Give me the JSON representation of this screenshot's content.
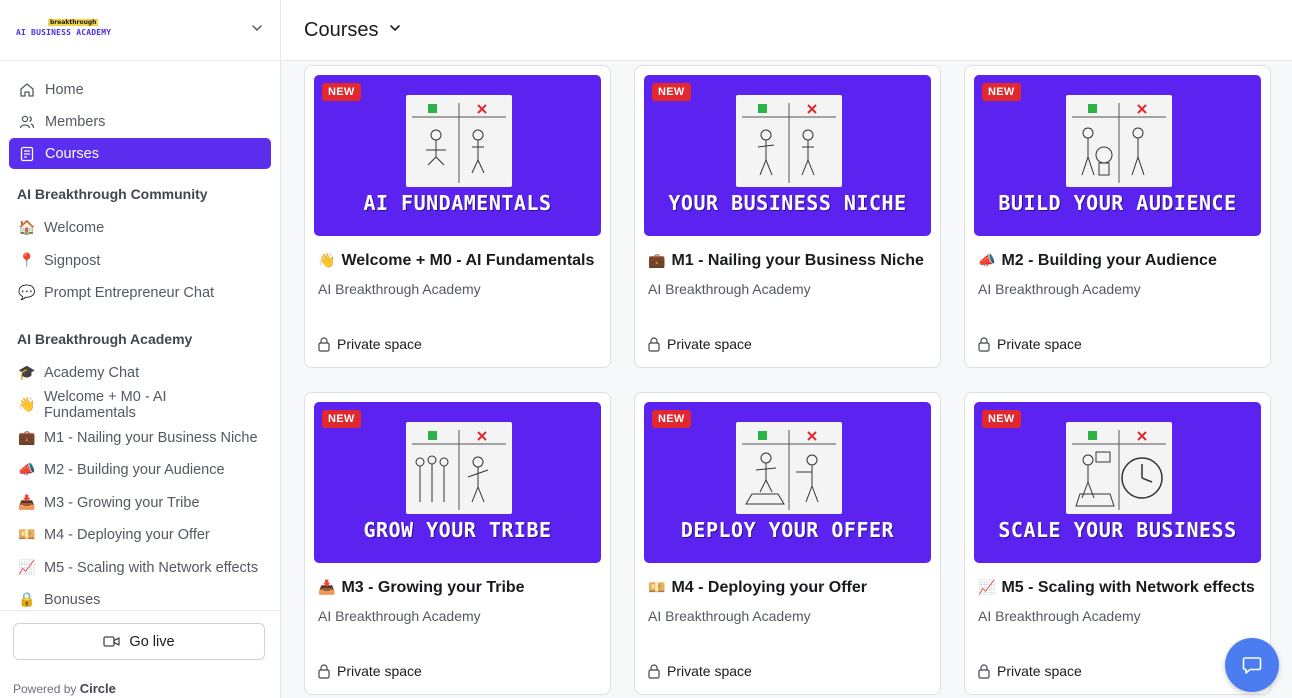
{
  "brand": {
    "logo_top": "breakthrough",
    "logo_bottom": "AI BUSINESS ACADEMY"
  },
  "nav": {
    "home": "Home",
    "members": "Members",
    "courses": "Courses"
  },
  "community": {
    "title": "AI Breakthrough Community",
    "items": [
      {
        "emoji": "🏠",
        "label": "Welcome"
      },
      {
        "emoji": "📍",
        "label": "Signpost"
      },
      {
        "emoji": "💬",
        "label": "Prompt Entrepreneur Chat"
      }
    ]
  },
  "academy": {
    "title": "AI Breakthrough Academy",
    "items": [
      {
        "emoji": "🎓",
        "label": "Academy Chat"
      },
      {
        "emoji": "👋",
        "label": "Welcome + M0 - AI Fundamentals"
      },
      {
        "emoji": "💼",
        "label": "M1 - Nailing your Business Niche"
      },
      {
        "emoji": "📣",
        "label": "M2 - Building your Audience"
      },
      {
        "emoji": "📥",
        "label": "M3 - Growing your Tribe"
      },
      {
        "emoji": "💴",
        "label": "M4 - Deploying your Offer"
      },
      {
        "emoji": "📈",
        "label": "M5 - Scaling with Network effects"
      },
      {
        "emoji": "🔒",
        "label": "Bonuses"
      }
    ]
  },
  "footer": {
    "go_live": "Go live",
    "powered_by": "Powered by",
    "powered_brand": "Circle"
  },
  "header": {
    "title": "Courses"
  },
  "cards": [
    {
      "badge": "NEW",
      "thumb_title": "AI FUNDAMENTALS",
      "emoji": "👋",
      "title": "Welcome + M0 - AI Fundamentals",
      "subtitle": "AI Breakthrough Academy",
      "privacy": "Private space"
    },
    {
      "badge": "NEW",
      "thumb_title": "YOUR BUSINESS NICHE",
      "emoji": "💼",
      "title": "M1 - Nailing your Business Niche",
      "subtitle": "AI Breakthrough Academy",
      "privacy": "Private space"
    },
    {
      "badge": "NEW",
      "thumb_title": "BUILD YOUR AUDIENCE",
      "emoji": "📣",
      "title": "M2 - Building your Audience",
      "subtitle": "AI Breakthrough Academy",
      "privacy": "Private space"
    },
    {
      "badge": "NEW",
      "thumb_title": "GROW YOUR TRIBE",
      "emoji": "📥",
      "title": "M3 - Growing your Tribe",
      "subtitle": "AI Breakthrough Academy",
      "privacy": "Private space"
    },
    {
      "badge": "NEW",
      "thumb_title": "DEPLOY YOUR OFFER",
      "emoji": "💴",
      "title": "M4 - Deploying your Offer",
      "subtitle": "AI Breakthrough Academy",
      "privacy": "Private space"
    },
    {
      "badge": "NEW",
      "thumb_title": "SCALE YOUR BUSINESS",
      "emoji": "📈",
      "title": "M5 - Scaling with Network effects",
      "subtitle": "AI Breakthrough Academy",
      "privacy": "Private space"
    }
  ],
  "colors": {
    "accent": "#5b2ef0",
    "thumb_bg": "#5b22f0",
    "badge": "#e0282e",
    "chat_fab": "#4b7df0"
  }
}
